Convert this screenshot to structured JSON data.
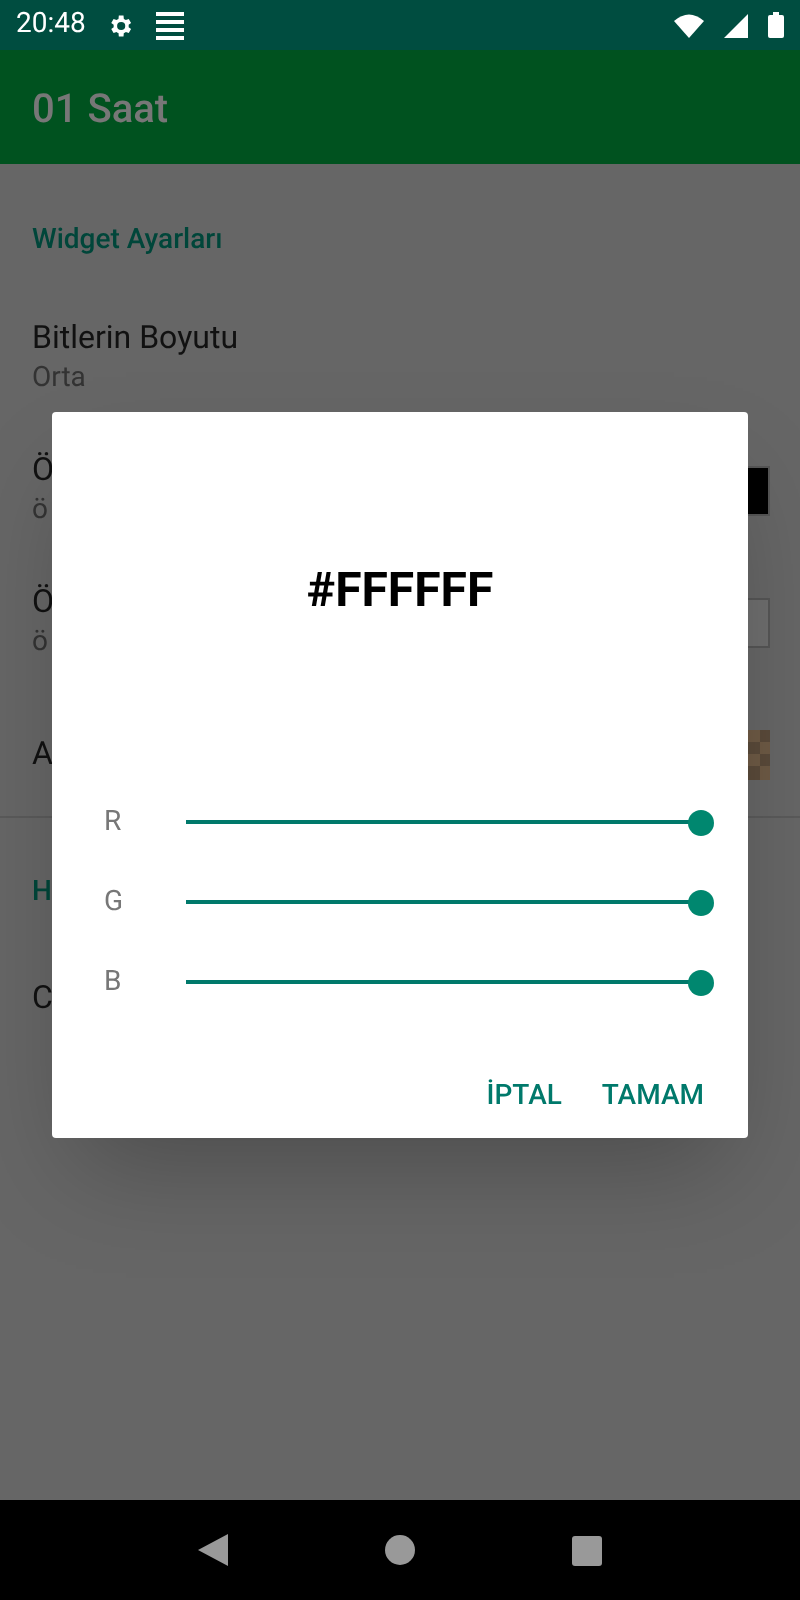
{
  "status_bar": {
    "time": "20:48"
  },
  "app_bar": {
    "title": "01 Saat"
  },
  "settings": {
    "section_title": "Widget Ayarları",
    "items": [
      {
        "kind": "text",
        "title": "Bitlerin Boyutu",
        "summary": "Orta"
      },
      {
        "kind": "swatch",
        "title": "Ö",
        "summary": "ö",
        "color": "#000000"
      },
      {
        "kind": "swatch",
        "title": "Ö",
        "summary": "ö",
        "color": "#6e6e6e"
      },
      {
        "kind": "checker",
        "title": "A"
      }
    ],
    "section2_title": "H",
    "items2": [
      {
        "title": "C"
      }
    ]
  },
  "dialog": {
    "title": "#FFFFFF",
    "sliders": [
      {
        "label": "R",
        "level": 1
      },
      {
        "label": "G",
        "level": 1
      },
      {
        "label": "B",
        "level": 1
      }
    ],
    "buttons": [
      "İPTAL",
      "TAMAM"
    ]
  }
}
